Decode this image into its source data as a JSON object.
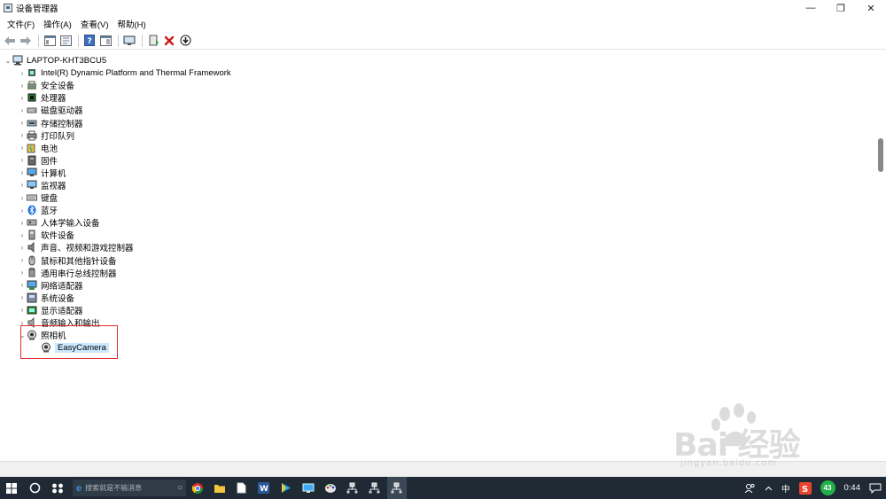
{
  "window": {
    "title": "设备管理器",
    "minimize": "—",
    "restore": "❐",
    "close": "✕"
  },
  "menu": [
    "文件(F)",
    "操作(A)",
    "查看(V)",
    "帮助(H)"
  ],
  "toolbar": {
    "icons": [
      "back-arrow",
      "forward-arrow",
      "properties-pane",
      "show-hide-console",
      "help",
      "show-action-pane",
      "monitor-scan",
      "update-driver",
      "uninstall-device",
      "download-driver"
    ]
  },
  "tree": {
    "root": "LAPTOP-KHT3BCU5",
    "categories": [
      {
        "label": "Intel(R) Dynamic Platform and Thermal Framework",
        "icon": "chip-icon"
      },
      {
        "label": "安全设备",
        "icon": "security-icon"
      },
      {
        "label": "处理器",
        "icon": "processor-icon"
      },
      {
        "label": "磁盘驱动器",
        "icon": "disk-icon"
      },
      {
        "label": "存储控制器",
        "icon": "storage-icon"
      },
      {
        "label": "打印队列",
        "icon": "printer-icon"
      },
      {
        "label": "电池",
        "icon": "battery-icon"
      },
      {
        "label": "固件",
        "icon": "firmware-icon"
      },
      {
        "label": "计算机",
        "icon": "computer-icon"
      },
      {
        "label": "监视器",
        "icon": "monitor-icon"
      },
      {
        "label": "键盘",
        "icon": "keyboard-icon"
      },
      {
        "label": "蓝牙",
        "icon": "bluetooth-icon"
      },
      {
        "label": "人体学输入设备",
        "icon": "hid-icon"
      },
      {
        "label": "软件设备",
        "icon": "software-icon"
      },
      {
        "label": "声音、视频和游戏控制器",
        "icon": "sound-icon"
      },
      {
        "label": "鼠标和其他指针设备",
        "icon": "mouse-icon"
      },
      {
        "label": "通用串行总线控制器",
        "icon": "usb-icon"
      },
      {
        "label": "网络适配器",
        "icon": "network-icon"
      },
      {
        "label": "系统设备",
        "icon": "system-icon"
      },
      {
        "label": "显示适配器",
        "icon": "display-icon"
      },
      {
        "label": "音频输入和输出",
        "icon": "audio-icon"
      }
    ],
    "expanded_category": {
      "label": "照相机",
      "icon": "camera-icon",
      "children": [
        {
          "label": "EasyCamera",
          "icon": "camera-icon",
          "selected": true
        }
      ]
    }
  },
  "watermark": {
    "text": "Bai 经验",
    "sub": "jingyan.baidu.com"
  },
  "taskbar": {
    "search_placeholder": "搜索就是不输消息",
    "tray": {
      "ime": "中",
      "badge": "43",
      "time": "0:44"
    }
  },
  "colors": {
    "highlight_box": "#e03030",
    "selection": "#cce8ff",
    "taskbar": "#1f2a35"
  }
}
